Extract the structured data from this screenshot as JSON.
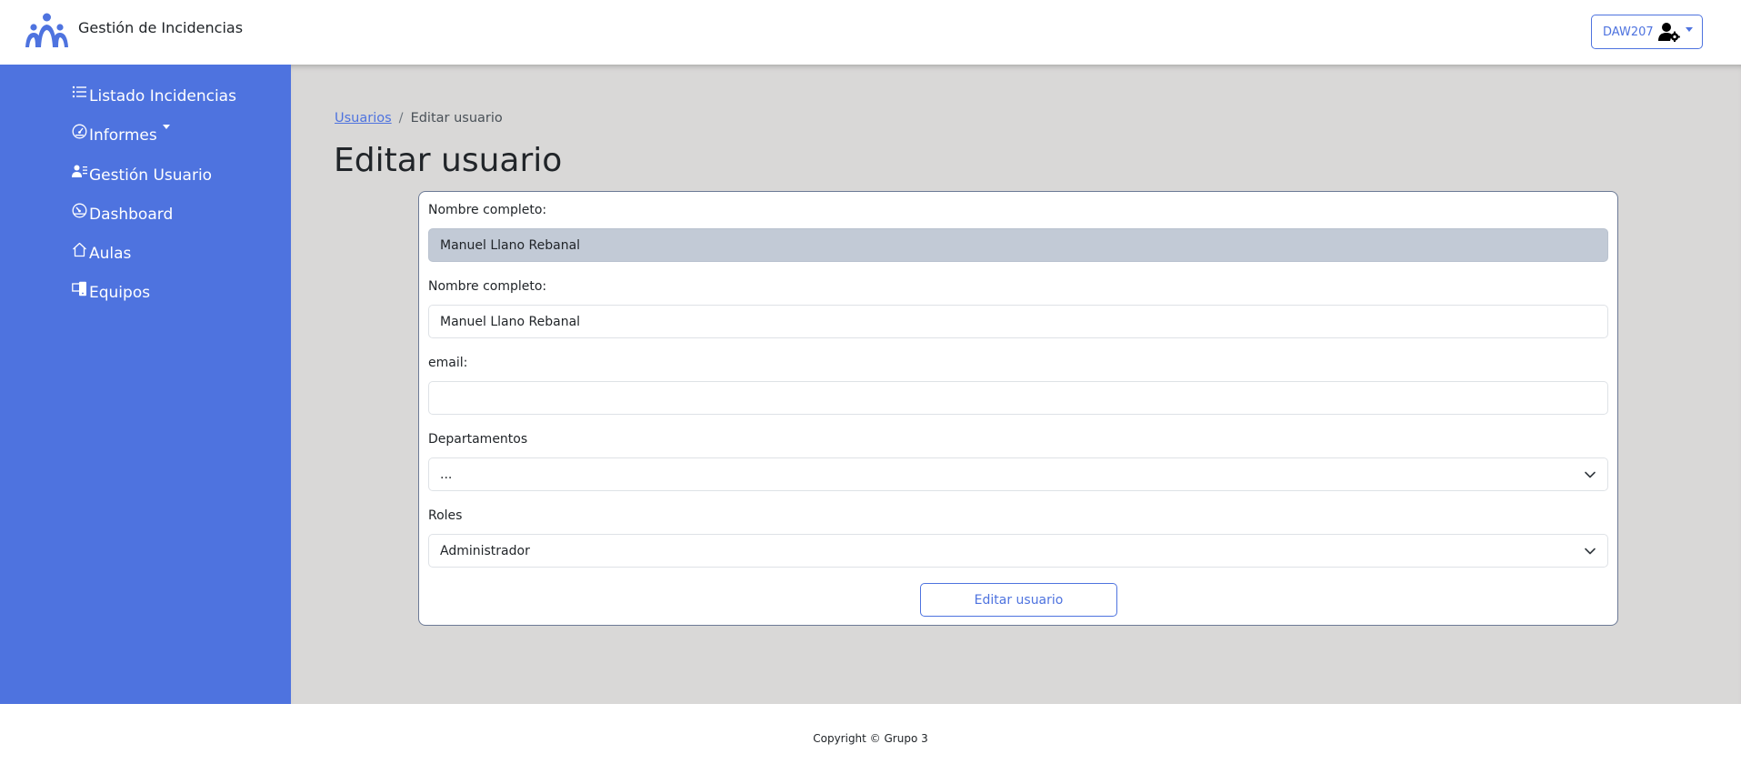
{
  "header": {
    "brand_title": "Gestión de Incidencias",
    "brand_logo": "people-group-logo",
    "user_label": "DAW207",
    "user_icon": "user-gear-icon"
  },
  "sidebar": {
    "items": [
      {
        "label": "Listado Incidencias",
        "icon": "list-icon"
      },
      {
        "label": "Informes",
        "icon": "gauge-icon",
        "has_dropdown": true
      },
      {
        "label": "Gestión Usuario",
        "icon": "users-list-icon"
      },
      {
        "label": "Dashboard",
        "icon": "speedometer-icon"
      },
      {
        "label": "Aulas",
        "icon": "house-icon"
      },
      {
        "label": "Equipos",
        "icon": "devices-icon"
      }
    ]
  },
  "breadcrumb": {
    "link": "Usuarios",
    "separator": "/",
    "current": "Editar usuario"
  },
  "page_title": "Editar usuario",
  "form": {
    "field1_label": "Nombre completo:",
    "field1_value": "Manuel Llano Rebanal",
    "field2_label": "Nombre completo:",
    "field2_value": "Manuel Llano Rebanal",
    "email_label": "email:",
    "email_value": "",
    "departamentos_label": "Departamentos",
    "departamentos_value": "...",
    "roles_label": "Roles",
    "roles_value": "Administrador",
    "submit_label": "Editar usuario"
  },
  "footer": {
    "copyright": "Copyright © Grupo 3"
  },
  "colors": {
    "accent": "#4e73df",
    "main_bg": "#d9d8d7",
    "disabled_input": "#c2cad6"
  }
}
